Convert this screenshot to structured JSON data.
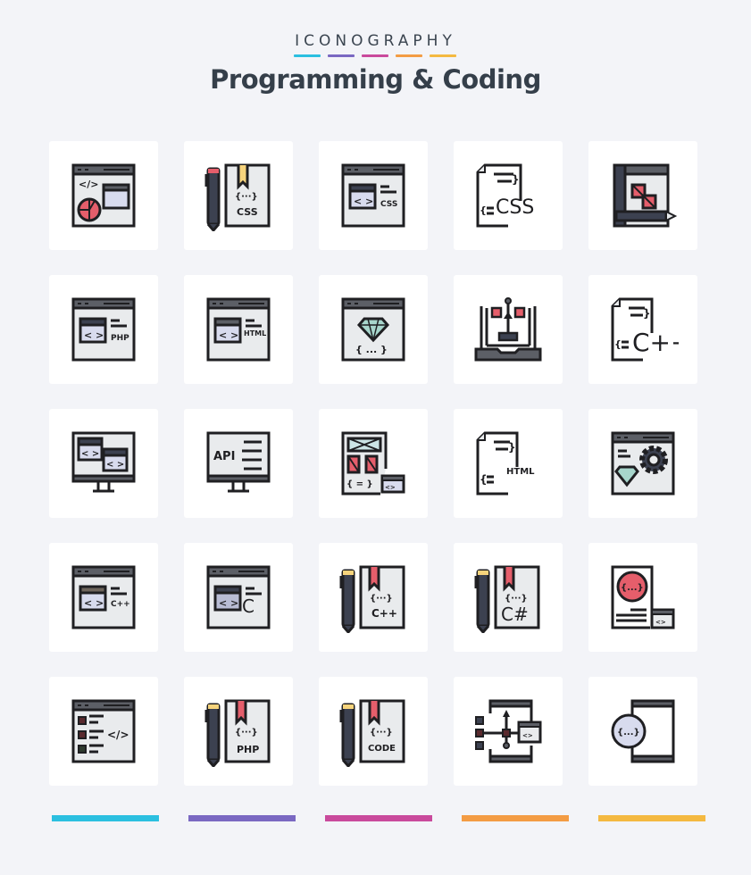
{
  "header": {
    "brand": "ICONOGRAPHY",
    "title": "Programming & Coding",
    "accent_colors": [
      "#2bbfe0",
      "#7a68c2",
      "#c94a9c",
      "#f39c44",
      "#f4b941"
    ]
  },
  "palette": {
    "outline": "#1f1f22",
    "window_bar": "#5c5f66",
    "panel": "#e9ebed",
    "lavender": "#d8dbee",
    "red": "#e55e6b",
    "yellow": "#f7d47c",
    "dark": "#3c4150",
    "teal": "#a7d6cc"
  },
  "icons": [
    {
      "name": "web-analytics-code",
      "label": ""
    },
    {
      "name": "css-book-pencil",
      "label": "CSS"
    },
    {
      "name": "browser-css",
      "label": "CSS"
    },
    {
      "name": "css-file",
      "label": "CSS"
    },
    {
      "name": "design-window-pencil",
      "label": ""
    },
    {
      "name": "browser-php",
      "label": "PHP"
    },
    {
      "name": "browser-html",
      "label": "HTML"
    },
    {
      "name": "browser-diamond-code",
      "label": "{ ... }"
    },
    {
      "name": "laptop-flowchart",
      "label": ""
    },
    {
      "name": "cpp-file",
      "label": "C++"
    },
    {
      "name": "monitor-code-windows",
      "label": ""
    },
    {
      "name": "monitor-api",
      "label": "API"
    },
    {
      "name": "wireframe-code",
      "label": "{ = }"
    },
    {
      "name": "html-file",
      "label": "HTML"
    },
    {
      "name": "browser-diamond-gear",
      "label": ""
    },
    {
      "name": "browser-cpp",
      "label": "C++"
    },
    {
      "name": "browser-c",
      "label": "C"
    },
    {
      "name": "cpp-book-pencil",
      "label": "C++"
    },
    {
      "name": "csharp-book-pencil",
      "label": "C#"
    },
    {
      "name": "code-document",
      "label": "{...}"
    },
    {
      "name": "browser-list-code",
      "label": "</>"
    },
    {
      "name": "php-book-pencil",
      "label": "PHP"
    },
    {
      "name": "code-book-pencil",
      "label": "CODE"
    },
    {
      "name": "mobile-flowchart",
      "label": ""
    },
    {
      "name": "mobile-code",
      "label": "{...}"
    }
  ],
  "footer": {
    "bars": [
      "#2bbfe0",
      "#7a68c2",
      "#c94a9c",
      "#f39c44",
      "#f4b941"
    ]
  }
}
